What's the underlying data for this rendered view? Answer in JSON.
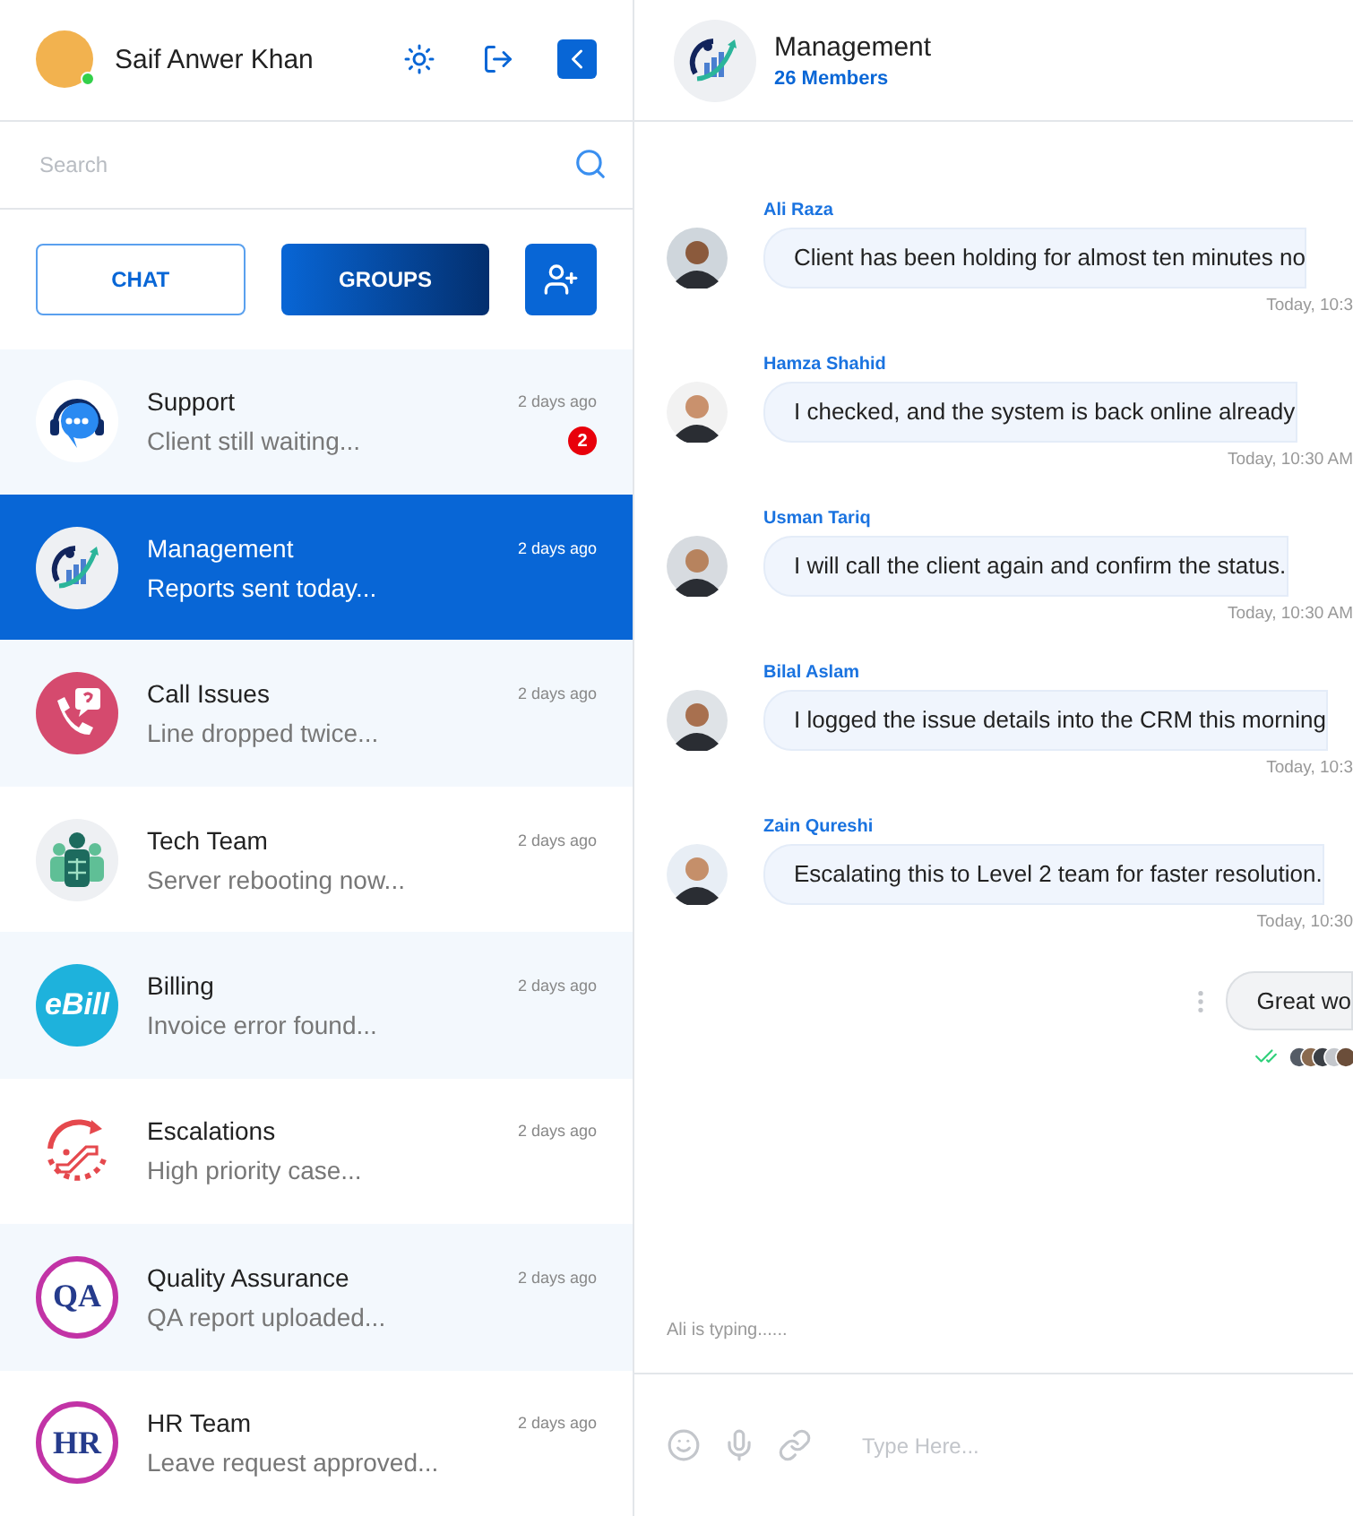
{
  "user": {
    "name": "Saif Anwer Khan",
    "online": true
  },
  "search": {
    "placeholder": "Search"
  },
  "tabs": [
    {
      "label": "CHAT",
      "selected": false
    },
    {
      "label": "GROUPS",
      "selected": true
    }
  ],
  "groups": [
    {
      "name": "Support",
      "preview": "Client still waiting...",
      "time": "2 days ago",
      "unread": "2",
      "kind": "headset",
      "selected": false
    },
    {
      "name": "Management",
      "preview": "Reports sent today...",
      "time": "2 days ago",
      "kind": "chart",
      "selected": true
    },
    {
      "name": "Call Issues",
      "preview": "Line dropped twice...",
      "time": "2 days ago",
      "kind": "phone",
      "selected": false
    },
    {
      "name": "Tech Team",
      "preview": "Server rebooting now...",
      "time": "2 days ago",
      "kind": "team",
      "selected": false
    },
    {
      "name": "Billing",
      "preview": "Invoice error found...",
      "time": "2 days ago",
      "kind": "logo",
      "logo_text": "eBill",
      "selected": false
    },
    {
      "name": "Escalations",
      "preview": "High priority case...",
      "time": "2 days ago",
      "kind": "escalator",
      "selected": false
    },
    {
      "name": "Quality Assurance",
      "preview": "QA report uploaded...",
      "time": "2 days ago",
      "kind": "logo",
      "logo_text": "QA",
      "selected": false
    },
    {
      "name": "HR Team",
      "preview": "Leave request approved...",
      "time": "2 days ago",
      "kind": "logo",
      "logo_text": "HR",
      "selected": false
    }
  ],
  "chat": {
    "title": "Management",
    "subtitle": "26 Members",
    "messages": [
      {
        "kind": "incoming",
        "sender": "Ali Raza",
        "text": "Client has been holding for almost ten minutes no",
        "time": "Today, 10:3"
      },
      {
        "kind": "incoming",
        "sender": "Hamza Shahid",
        "text": "I checked, and the system is back online already",
        "time": "Today, 10:30 AM"
      },
      {
        "kind": "incoming",
        "sender": "Usman Tariq",
        "text": "I will call the client again and confirm the status.",
        "time": "Today, 10:30 AM"
      },
      {
        "kind": "incoming",
        "sender": "Bilal Aslam",
        "text": "I logged the issue details into the CRM this morning",
        "time": "Today, 10:3"
      },
      {
        "kind": "incoming",
        "sender": "Zain Qureshi",
        "text": "Escalating this to Level 2 team for faster resolution.",
        "time": "Today, 10:30"
      },
      {
        "kind": "outgoing",
        "text": "Great wo",
        "read": true
      }
    ],
    "typing": "Ali is typing......",
    "composer": {
      "placeholder": "Type Here..."
    }
  }
}
